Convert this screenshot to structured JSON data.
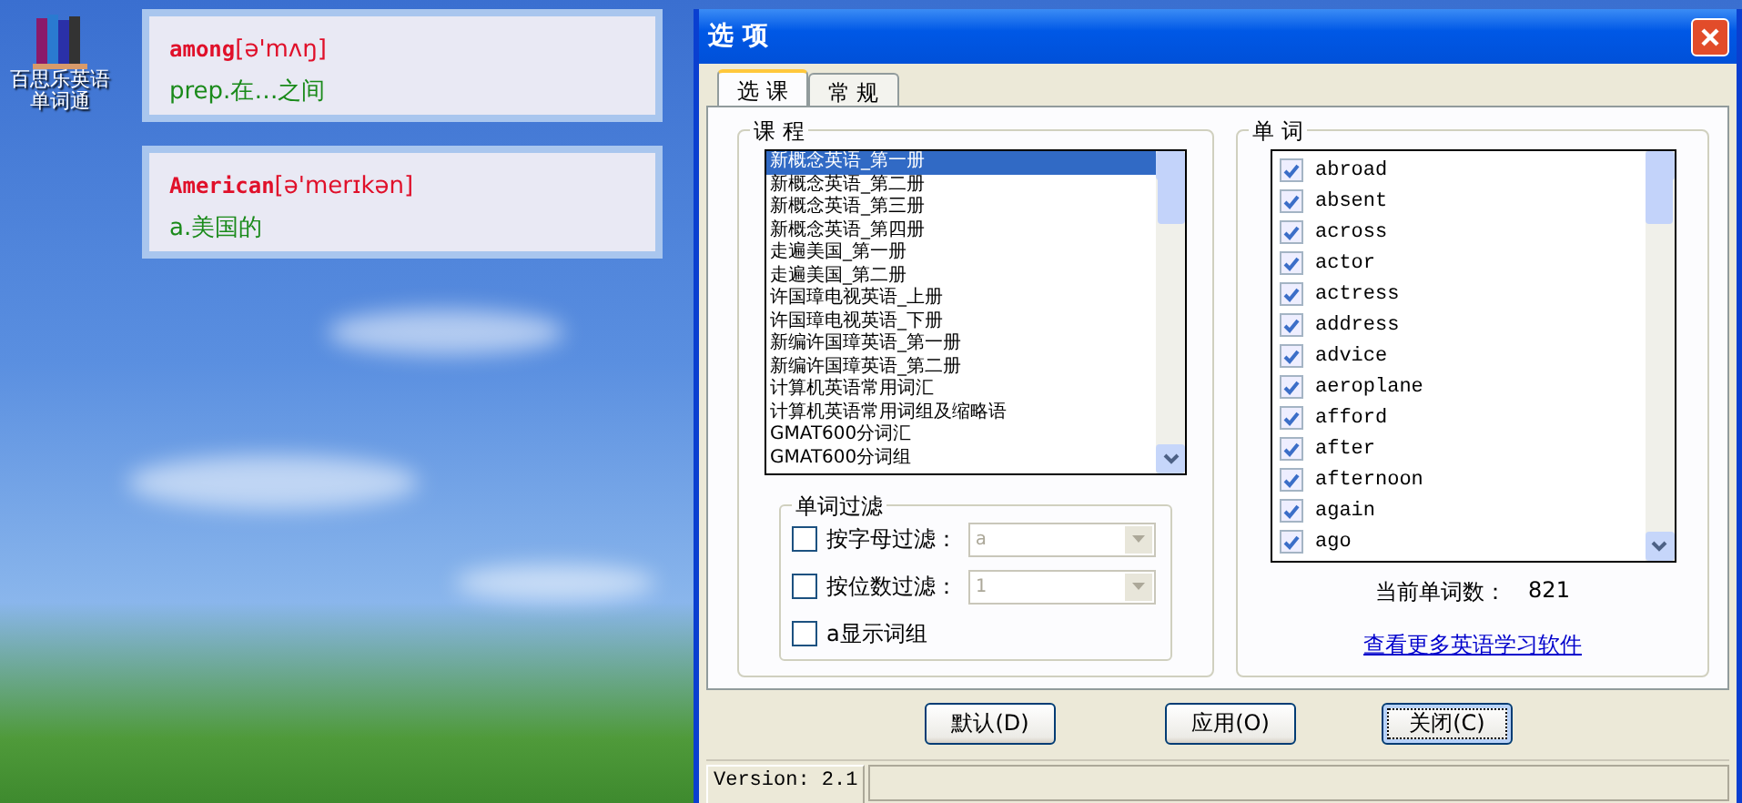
{
  "desktop_icon": {
    "label": "百思乐英语单词通"
  },
  "popups": [
    {
      "word": "among",
      "phonetic": "[ə'mʌŋ]",
      "definition": "prep.在…之间"
    },
    {
      "word": "American",
      "phonetic": "[ə'merɪkən]",
      "definition": "a.美国的"
    }
  ],
  "dialog": {
    "title": "选 项",
    "tabs": [
      {
        "label": "选 课",
        "selected": true
      },
      {
        "label": "常 规",
        "selected": false
      }
    ],
    "courses": {
      "title": "课 程",
      "items": [
        {
          "label": "新概念英语_第一册",
          "selected": true
        },
        {
          "label": "新概念英语_第二册",
          "selected": false
        },
        {
          "label": "新概念英语_第三册",
          "selected": false
        },
        {
          "label": "新概念英语_第四册",
          "selected": false
        },
        {
          "label": "走遍美国_第一册",
          "selected": false
        },
        {
          "label": "走遍美国_第二册",
          "selected": false
        },
        {
          "label": "许国璋电视英语_上册",
          "selected": false
        },
        {
          "label": "许国璋电视英语_下册",
          "selected": false
        },
        {
          "label": "新编许国璋英语_第一册",
          "selected": false
        },
        {
          "label": "新编许国璋英语_第二册",
          "selected": false
        },
        {
          "label": "计算机英语常用词汇",
          "selected": false
        },
        {
          "label": "计算机英语常用词组及缩略语",
          "selected": false
        },
        {
          "label": "GMAT600分词汇",
          "selected": false
        },
        {
          "label": "GMAT600分词组",
          "selected": false
        }
      ]
    },
    "filter": {
      "title": "单词过滤",
      "options": [
        {
          "kind": "dropdown",
          "label": "按字母过滤：",
          "checked": false,
          "value": "a",
          "disabled": true
        },
        {
          "kind": "dropdown",
          "label": "按位数过滤：",
          "checked": false,
          "value": "1",
          "disabled": true
        },
        {
          "kind": "plain",
          "label": "a显示词组",
          "checked": false
        }
      ]
    },
    "words": {
      "title": "单 词",
      "items": [
        {
          "label": "abroad",
          "checked": true
        },
        {
          "label": "absent",
          "checked": true
        },
        {
          "label": "across",
          "checked": true
        },
        {
          "label": "actor",
          "checked": true
        },
        {
          "label": "actress",
          "checked": true
        },
        {
          "label": "address",
          "checked": true
        },
        {
          "label": "advice",
          "checked": true
        },
        {
          "label": "aeroplane",
          "checked": true
        },
        {
          "label": "afford",
          "checked": true
        },
        {
          "label": "after",
          "checked": true
        },
        {
          "label": "afternoon",
          "checked": true
        },
        {
          "label": "again",
          "checked": true
        },
        {
          "label": "ago",
          "checked": true
        }
      ],
      "count_label": "当前单词数：",
      "count": "821",
      "link": "查看更多英语学习软件"
    },
    "buttons": [
      {
        "label": "默认(D)",
        "focused": false
      },
      {
        "label": "应用(O)",
        "focused": false
      },
      {
        "label": "关闭(C)",
        "focused": true
      }
    ],
    "status": "Version: 2.1"
  }
}
